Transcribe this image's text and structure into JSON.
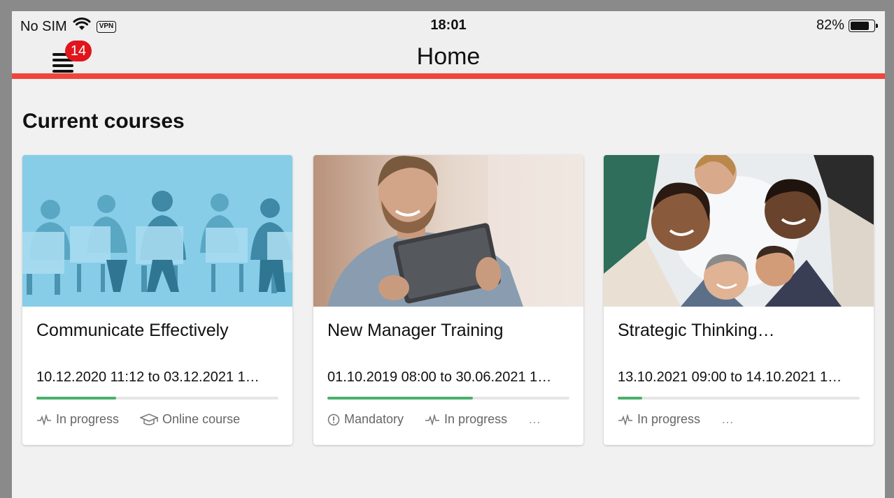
{
  "status_bar": {
    "carrier": "No SIM",
    "vpn": "VPN",
    "time": "18:01",
    "battery": "82%",
    "battery_level": 0.82
  },
  "nav": {
    "title": "Home",
    "notification_count": "14"
  },
  "colors": {
    "accent": "#f0453a",
    "badge": "#e0161c",
    "progress": "#4caf6a"
  },
  "section": {
    "title": "Current courses"
  },
  "courses": [
    {
      "title": "Communicate Effectively",
      "dates": "10.12.2020 11:12 to 03.12.2021 1…",
      "progress": 0.33,
      "tags": [
        "In progress",
        "Online course"
      ]
    },
    {
      "title": "New Manager Training",
      "dates": "01.10.2019 08:00 to 30.06.2021 1…",
      "progress": 0.6,
      "tags": [
        "Mandatory",
        "In progress",
        "…"
      ]
    },
    {
      "title": "Strategic Thinking…",
      "dates": "13.10.2021 09:00 to 14.10.2021 1…",
      "progress": 0.1,
      "tags": [
        "In progress",
        "…"
      ]
    }
  ]
}
